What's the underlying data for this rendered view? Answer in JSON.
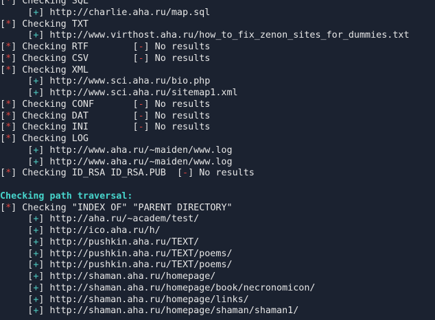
{
  "terminal": {
    "lines": [
      {
        "kind": "check",
        "text": "Checking SQL"
      },
      {
        "kind": "found",
        "text": "http://charlie.aha.ru/map.sql"
      },
      {
        "kind": "check",
        "text": "Checking TXT"
      },
      {
        "kind": "found",
        "text": "http://www.virthost.aha.ru/how_to_fix_zenon_sites_for_dummies.txt"
      },
      {
        "kind": "check_none",
        "text": "Checking RTF",
        "result": "No results"
      },
      {
        "kind": "check_none",
        "text": "Checking CSV",
        "result": "No results"
      },
      {
        "kind": "check",
        "text": "Checking XML"
      },
      {
        "kind": "found",
        "text": "http://www.sci.aha.ru/bio.php"
      },
      {
        "kind": "found",
        "text": "http://www.sci.aha.ru/sitemap1.xml"
      },
      {
        "kind": "check_none",
        "text": "Checking CONF",
        "result": "No results"
      },
      {
        "kind": "check_none",
        "text": "Checking DAT",
        "result": "No results"
      },
      {
        "kind": "check_none",
        "text": "Checking INI",
        "result": "No results"
      },
      {
        "kind": "check",
        "text": "Checking LOG"
      },
      {
        "kind": "found",
        "text": "http://www.aha.ru/~maiden/www.log"
      },
      {
        "kind": "found",
        "text": "http://www.aha.ru/~maiden/www.log"
      },
      {
        "kind": "check_none_inline",
        "text": "Checking ID_RSA ID_RSA.PUB",
        "result": "No results"
      },
      {
        "kind": "blank",
        "text": ""
      },
      {
        "kind": "heading",
        "text": "Checking path traversal:"
      },
      {
        "kind": "check",
        "text": "Checking \"INDEX OF\" \"PARENT DIRECTORY\""
      },
      {
        "kind": "found",
        "text": "http://aha.ru/~academ/test/"
      },
      {
        "kind": "found",
        "text": "http://ico.aha.ru/h/"
      },
      {
        "kind": "found",
        "text": "http://pushkin.aha.ru/TEXT/"
      },
      {
        "kind": "found",
        "text": "http://pushkin.aha.ru/TEXT/poems/"
      },
      {
        "kind": "found",
        "text": "http://pushkin.aha.ru/TEXT/poems/"
      },
      {
        "kind": "found",
        "text": "http://shaman.aha.ru/homepage/"
      },
      {
        "kind": "found",
        "text": "http://shaman.aha.ru/homepage/book/necronomicon/"
      },
      {
        "kind": "found",
        "text": "http://shaman.aha.ru/homepage/links/"
      },
      {
        "kind": "found",
        "text": "http://shaman.aha.ru/homepage/shaman/shaman1/"
      }
    ],
    "markers": {
      "star": "*",
      "plus": "+",
      "minus": "-"
    },
    "colors": {
      "background": "#1b2230",
      "text": "#e6e6e6",
      "star": "#e0443e",
      "plus": "#4ec9c0",
      "heading": "#47d5cc"
    }
  }
}
